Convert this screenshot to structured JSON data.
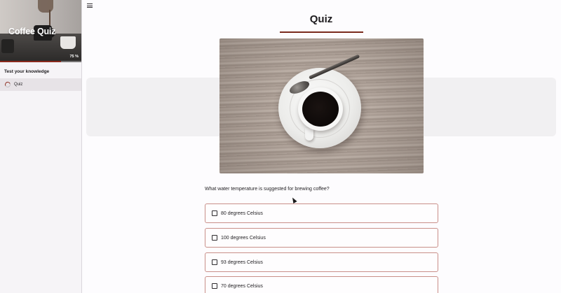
{
  "sidebar": {
    "hero_title": "Coffee Quiz",
    "progress_label": "75 %",
    "progress_value": 0.75,
    "section_title": "Test your knowledge",
    "items": [
      {
        "label": "Quiz",
        "icon": "progress-spinner-icon"
      }
    ]
  },
  "header": {
    "menu_icon": "hamburger-menu-icon"
  },
  "main": {
    "title": "Quiz",
    "image_icon": "coffee-cup-photo",
    "question": "What water temperature is suggested for brewing coffee?",
    "options": [
      {
        "label": "80 degrees Celsius",
        "checked": false
      },
      {
        "label": "100 degrees Celsius",
        "checked": false
      },
      {
        "label": "93 degrees Celsius",
        "checked": false
      },
      {
        "label": "70 degrees Celsius",
        "checked": false
      }
    ]
  },
  "colors": {
    "accent": "#7a2a1c",
    "option_border": "#c98f89",
    "sidebar_bg": "#f6f4f7",
    "panel_bg": "#f1f0f2"
  }
}
